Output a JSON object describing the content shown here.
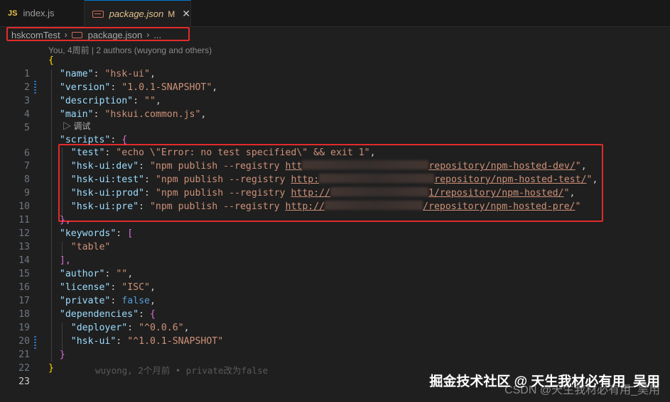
{
  "tabs": [
    {
      "badge": "JS",
      "label": "index.js"
    },
    {
      "label": "package.json",
      "modified": "M",
      "close": "✕"
    }
  ],
  "breadcrumb": {
    "root": "hskcomTest",
    "sep": "›",
    "file": "package.json",
    "more": "..."
  },
  "blame_header": "You, 4周前 | 2 authors (wuyong and others)",
  "codelens": "▷ 调试",
  "inline_blame": "wuyong, 2个月前 • private改为false",
  "watermark": {
    "line1": "掘金技术社区 @ 天生我材必有用_吴用",
    "line2": "CSDN @天生我材必有用_吴用"
  },
  "code": {
    "l1": "{",
    "l2_key": "\"name\"",
    "l2_val": "\"hsk-ui\"",
    "l3_key": "\"version\"",
    "l3_val": "\"1.0.1-SNAPSHOT\"",
    "l4_key": "\"description\"",
    "l4_val": "\"\"",
    "l5_key": "\"main\"",
    "l5_val": "\"hskui.common.js\"",
    "l6_key": "\"scripts\"",
    "l7_key": "\"test\"",
    "l7_val": "\"echo \\\"Error: no test specified\\\" && exit 1\"",
    "l8_key": "\"hsk-ui:dev\"",
    "l8_pre": "\"npm publish --registry ",
    "l8_url_a": "htt",
    "l8_url_b": "repository/npm-hosted-dev/",
    "l8_end": "\"",
    "l9_key": "\"hsk-ui:test\"",
    "l9_pre": "\"npm publish --registry ",
    "l9_url_a": "http:",
    "l9_url_b": "repository/npm-hosted-test/",
    "l9_end": "\"",
    "l10_key": "\"hsk-ui:prod\"",
    "l10_pre": "\"npm publish --registry ",
    "l10_url_a": "http://",
    "l10_url_b": "1/repository/npm-hosted/",
    "l10_end": "\"",
    "l11_key": "\"hsk-ui:pre\"",
    "l11_pre": "\"npm publish --registry ",
    "l11_url_a": "http://",
    "l11_url_b": "/repository/npm-hosted-pre/",
    "l11_end": "\"",
    "l12": "},",
    "l13_key": "\"keywords\"",
    "l14_val": "\"table\"",
    "l15": "],",
    "l16_key": "\"author\"",
    "l16_val": "\"\"",
    "l17_key": "\"license\"",
    "l17_val": "\"ISC\"",
    "l18_key": "\"private\"",
    "l18_val": "false",
    "l19_key": "\"dependencies\"",
    "l20_key": "\"deployer\"",
    "l20_val": "\"^0.0.6\"",
    "l21_key": "\"hsk-ui\"",
    "l21_val": "\"^1.0.1-SNAPSHOT\"",
    "l22": "}",
    "l23": "}"
  },
  "line_numbers": [
    "1",
    "2",
    "3",
    "4",
    "5",
    "6",
    "7",
    "8",
    "9",
    "10",
    "11",
    "12",
    "13",
    "14",
    "15",
    "16",
    "17",
    "18",
    "19",
    "20",
    "21",
    "22",
    "23"
  ]
}
